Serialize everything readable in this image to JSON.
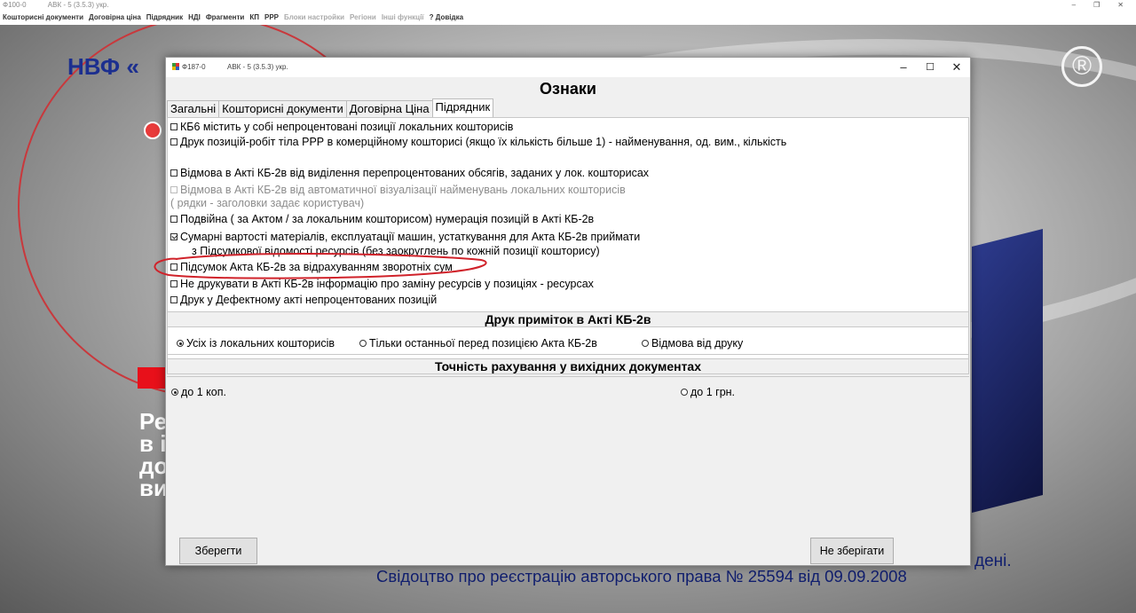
{
  "main_window": {
    "title_code": "Ф100-0",
    "title_app": "АВК - 5 (3.5.3) укр.",
    "controls": {
      "minimize": "–",
      "restore": "❐",
      "close": "✕"
    },
    "menu": [
      {
        "label": "Кошторисні документи",
        "enabled": true
      },
      {
        "label": "Договірна ціна",
        "enabled": true
      },
      {
        "label": "Підрядник",
        "enabled": true
      },
      {
        "label": "НДІ",
        "enabled": true
      },
      {
        "label": "Фрагменти",
        "enabled": true
      },
      {
        "label": "КП",
        "enabled": true
      },
      {
        "label": "РРР",
        "enabled": true
      },
      {
        "label": "Блоки настройки",
        "enabled": false
      },
      {
        "label": "Регіони",
        "enabled": false
      },
      {
        "label": "Інші функції",
        "enabled": false
      },
      {
        "label": "? Довідка",
        "enabled": true
      }
    ]
  },
  "background": {
    "company_text": "НВФ «",
    "registered_mark": "®",
    "left_words": [
      "Ре",
      "в і",
      "до",
      "ви"
    ],
    "footer_line1": "дені.",
    "footer_line2": "Свідоцтво про реєстрацію авторського права № 25594 від 09.09.2008"
  },
  "dialog": {
    "title_code": "Ф187-0",
    "title_app": "АВК - 5 (3.5.3) укр.",
    "controls": {
      "minimize": "–",
      "maximize": "☐",
      "close": "✕"
    },
    "heading": "Ознаки",
    "tabs": [
      {
        "label": "Загальні",
        "active": false
      },
      {
        "label": "Кошторисні документи",
        "active": false
      },
      {
        "label": "Договірна Ціна",
        "active": false
      },
      {
        "label": "Підрядник",
        "active": true
      }
    ],
    "options": [
      {
        "label": "КБ6 містить у собі непроцентовані позиції локальних кошторисів",
        "checked": false,
        "enabled": true
      },
      {
        "label": "Друк позицій-робіт тіла РРР в комерційному кошторисі (якщо їх кількість більше 1) - найменування, од. вим., кількість",
        "checked": false,
        "enabled": true
      },
      {
        "label": "Відмова в Акті КБ-2в від виділення перепроцентованих обсягів, заданих у лок. кошторисах",
        "checked": false,
        "enabled": true
      },
      {
        "label": "Відмова в Акті КБ-2в від автоматичної візуалізації найменувань локальних кошторисів",
        "continuation": "( рядки - заголовки задає користувач)",
        "checked": false,
        "enabled": false
      },
      {
        "label": "Подвійна ( за Актом / за локальним кошторисом) нумерація позицій в Акті КБ-2в",
        "checked": false,
        "enabled": true
      },
      {
        "label": "Сумарні вартості матеріалів, експлуатації машин, устаткування для Акта КБ-2в приймати",
        "continuation": "з Підсумкової відомості ресурсів (без заокруглень по кожній позиції кошторису)",
        "checked": true,
        "enabled": true
      },
      {
        "label": "Підсумок Акта КБ-2в за відрахуванням зворотніх сум",
        "checked": false,
        "enabled": true
      },
      {
        "label": "Не друкувати в Акті КБ-2в інформацію про заміну ресурсів у позиціях - ресурсах",
        "checked": false,
        "enabled": true
      },
      {
        "label": "Друк у Дефектному акті непроцентованих позицій",
        "checked": false,
        "enabled": true
      }
    ],
    "notes_section": {
      "title": "Друк приміток в Акті КБ-2в",
      "options": [
        {
          "label": "Усіх із локальних кошторисів",
          "selected": true
        },
        {
          "label": "Тільки останньої перед позицією Акта КБ-2в",
          "selected": false
        },
        {
          "label": "Відмова від друку",
          "selected": false
        }
      ]
    },
    "precision_section": {
      "title": "Точність рахування у вихідних документах",
      "options": [
        {
          "label": "до 1 коп.",
          "selected": true
        },
        {
          "label": "до 1 грн.",
          "selected": false
        }
      ]
    },
    "buttons": {
      "save": "Зберегти",
      "dont_save": "Не зберігати"
    },
    "highlight_color": "#d0222a"
  }
}
